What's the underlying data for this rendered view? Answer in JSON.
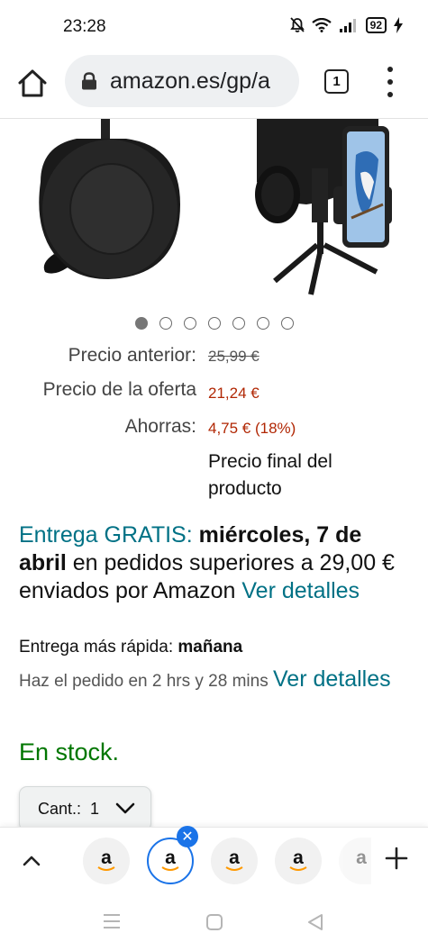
{
  "status_bar": {
    "time": "23:28",
    "battery": "92",
    "icons": [
      "bell-mute-icon",
      "wifi-icon",
      "signal-icon",
      "battery-icon",
      "charging-icon"
    ]
  },
  "browser": {
    "url": "amazon.es/gp/a",
    "tab_count": "1",
    "icons": [
      "home-icon",
      "lock-icon",
      "more-vert-icon"
    ]
  },
  "gallery": {
    "dot_count": 7,
    "active_dot": 1
  },
  "prices": {
    "previous_label": "Precio anterior:",
    "previous_value": "25,99 €",
    "offer_label": "Precio de la oferta",
    "offer_value": "21,24 €",
    "savings_label": "Ahorras:",
    "savings_value": "4,75 € (18%)",
    "final_note": "Precio final del producto"
  },
  "delivery": {
    "free_label": "Entrega GRATIS:",
    "date": "miércoles, 7 de abril",
    "condition": "en pedidos superiores a 29,00 € enviados por Amazon",
    "details_link": "Ver detalles",
    "fast_label": "Entrega más rápida:",
    "fast_value": "mañana",
    "order_within": "Haz el pedido en 2 hrs y 28 mins",
    "fast_details_link": "Ver detalles"
  },
  "stock": "En stock.",
  "quantity": {
    "label": "Cant.:",
    "value": "1"
  },
  "tab_strip": {
    "tabs": [
      {
        "letter": "a",
        "active": false
      },
      {
        "letter": "a",
        "active": true
      },
      {
        "letter": "a",
        "active": false
      },
      {
        "letter": "a",
        "active": false
      },
      {
        "letter": "a",
        "active": false
      }
    ],
    "icons": [
      "chevron-up-icon",
      "close-icon",
      "plus-icon"
    ]
  },
  "nav_bar": {
    "icons": [
      "menu-icon",
      "home-square-icon",
      "back-triangle-icon"
    ]
  },
  "colors": {
    "link": "#007185",
    "price_red": "#b12704",
    "stock_green": "#007600",
    "tab_active": "#1a73e8"
  }
}
